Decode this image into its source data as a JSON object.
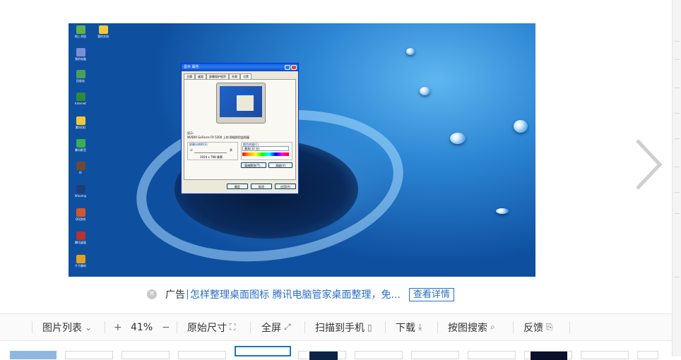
{
  "preview": {
    "desktop_icons": [
      "网上邻居",
      "我的文档",
      "我的电脑",
      "回收站",
      "Internet",
      "腾讯QQ",
      "暴风影音",
      "IE",
      "Winamp",
      "QQ游戏",
      "腾讯桌面",
      "千千静听"
    ],
    "dialog": {
      "title": "显示 属性",
      "tabs": [
        "主题",
        "桌面",
        "屏幕保护程序",
        "外观",
        "设置"
      ],
      "display_label": "显示:",
      "display_value": "NVIDIA GeForce FX 5200    上的 即插即用监视器",
      "resolution_label": "屏幕分辨率(S)",
      "slider_min": "少",
      "slider_max": "多",
      "resolution_value": "1024 x 768 像素",
      "color_label": "颜色质量(C)",
      "color_value": "最高(32 位)",
      "troubleshoot": "疑难解答(T)...",
      "advanced": "高级(V)",
      "ok": "确定",
      "cancel": "取消",
      "apply": "应用(A)"
    }
  },
  "ad": {
    "close_icon": "close-icon",
    "label": "广告",
    "link": "怎样整理桌面图标 腾讯电脑管家桌面整理，免...",
    "button": "查看详情"
  },
  "nav": {
    "next_icon": "chevron-right-icon"
  },
  "toolbar": {
    "image_list": "图片列表",
    "zoom_in": "+",
    "zoom": "41%",
    "zoom_out": "−",
    "original_size": "原始尺寸",
    "fullscreen": "全屏",
    "scan_to_phone": "扫描到手机",
    "download": "下载",
    "search_by_image": "按图搜索",
    "feedback": "反馈"
  },
  "colors": {
    "accent": "#2b6ec8",
    "selected_thumb_border": "#1d74c9"
  }
}
